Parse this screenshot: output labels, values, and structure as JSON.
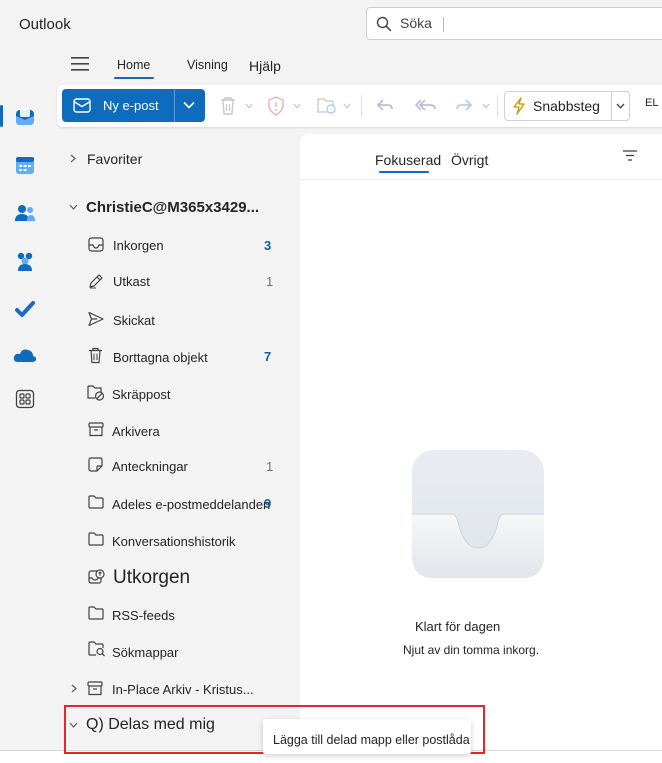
{
  "app": {
    "title": "Outlook"
  },
  "search": {
    "placeholder": "Söka"
  },
  "menu": {
    "tabs": [
      {
        "label": "Home",
        "selected": true
      },
      {
        "label": "Visning",
        "selected": false
      },
      {
        "label": "Hjälp",
        "selected": false
      }
    ]
  },
  "ribbon": {
    "new_mail_label": "Ny e-post",
    "quick_steps_label": "Snabbsteg",
    "overflow_label": "EL"
  },
  "rail": {
    "items": [
      "mail-icon",
      "calendar-icon",
      "people-icon",
      "teams-icon",
      "todo-icon",
      "onedrive-icon",
      "apps-icon"
    ],
    "selected": "mail-icon"
  },
  "folders": {
    "favorites_label": "Favoriter",
    "account_label": "ChristieC@M365x3429...",
    "items": [
      {
        "label": "Inkorgen",
        "count": "3",
        "icon": "inbox-icon"
      },
      {
        "label": "Utkast",
        "count": "1",
        "icon": "drafts-icon"
      },
      {
        "label": "Skickat",
        "count": "",
        "icon": "sent-icon"
      },
      {
        "label": "Borttagna objekt",
        "count": "7",
        "icon": "trash-icon"
      },
      {
        "label": "Skräppost",
        "count": "",
        "icon": "junk-icon"
      },
      {
        "label": "Arkivera",
        "count": "",
        "icon": "archive-icon"
      },
      {
        "label": "Anteckningar",
        "count": "1",
        "icon": "notes-icon"
      },
      {
        "label": "Adeles e-postmeddelanden",
        "count": "9",
        "icon": "folder-icon"
      },
      {
        "label": "Konversationshistorik",
        "count": "",
        "icon": "folder-icon"
      },
      {
        "label": "Utkorgen",
        "count": "",
        "icon": "outbox-icon"
      },
      {
        "label": "RSS-feeds",
        "count": "",
        "icon": "folder-icon"
      },
      {
        "label": "Sökmappar",
        "count": "",
        "icon": "search-folder-icon"
      }
    ],
    "archive_label": "In-Place Arkiv - Kristus...",
    "shared_label": "Q) Delas med mig"
  },
  "message_list": {
    "pivots": [
      "Fokuserad",
      "Övrigt"
    ],
    "selected_pivot": "Fokuserad",
    "empty_title": "Klart för dagen",
    "empty_subtitle": "Njut av din tomma inkorg."
  },
  "tooltip": {
    "text": "Lägga till delad mapp eller postlåda"
  },
  "colors": {
    "accent": "#0f6cbd",
    "highlight": "#e3262b",
    "unread_count": "#115ea3"
  }
}
